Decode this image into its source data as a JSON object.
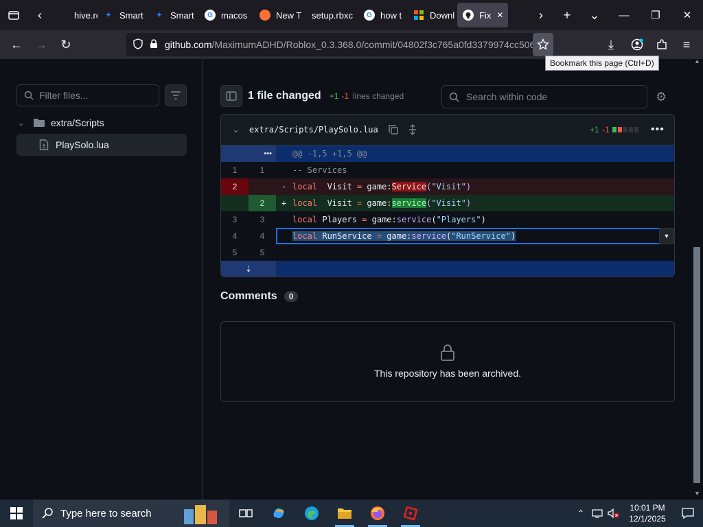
{
  "browser": {
    "tabs": [
      {
        "label": "hive.ro",
        "favicon": "archive-icon"
      },
      {
        "label": "Smart",
        "favicon": "bird-icon"
      },
      {
        "label": "Smart",
        "favicon": "bird-icon"
      },
      {
        "label": "macos",
        "favicon": "google-icon"
      },
      {
        "label": "New T",
        "favicon": "firefox-icon"
      },
      {
        "label": "setup.rbxc",
        "favicon": "none"
      },
      {
        "label": "how t",
        "favicon": "google-icon"
      },
      {
        "label": "Downl",
        "favicon": "windows-icon"
      },
      {
        "label": "Fix",
        "favicon": "github-icon",
        "active": true
      }
    ],
    "url_host": "github.com",
    "url_path": "/MaximumADHD/Roblox_0.3.368.0/commit/04802f3c765a0fd3379974cc506",
    "tooltip": "Bookmark this page (Ctrl+D)"
  },
  "sidebar": {
    "filter_placeholder": "Filter files...",
    "folder": "extra/Scripts",
    "file": "PlaySolo.lua"
  },
  "diff_summary": {
    "files_changed": "1 file changed",
    "additions": "+1",
    "deletions": "-1",
    "lines_changed": "lines changed",
    "search_placeholder": "Search within code"
  },
  "file": {
    "path": "extra/Scripts/PlaySolo.lua",
    "additions": "+1",
    "deletions": "-1"
  },
  "diff": {
    "hunk": "@@ -1,5 +1,5 @@",
    "rows": [
      {
        "old": "1",
        "new": "1",
        "marker": "",
        "parts": [
          [
            "cm",
            "-- Services"
          ]
        ]
      },
      {
        "old": "2",
        "new": "",
        "marker": "-",
        "parts": [
          [
            "kw",
            "local"
          ],
          [
            "",
            "  Visit "
          ],
          [
            "kw",
            "="
          ],
          [
            "",
            " game:"
          ],
          [
            "hl-del",
            "Service"
          ],
          [
            "fn",
            "("
          ],
          [
            "str",
            "\"Visit\""
          ],
          [
            "fn",
            ")"
          ]
        ]
      },
      {
        "old": "",
        "new": "2",
        "marker": "+",
        "parts": [
          [
            "kw",
            "local"
          ],
          [
            "",
            "  Visit "
          ],
          [
            "kw",
            "="
          ],
          [
            "",
            " game:"
          ],
          [
            "hl-add",
            "service"
          ],
          [
            "fn",
            "("
          ],
          [
            "str",
            "\"Visit\""
          ],
          [
            "fn",
            ")"
          ]
        ]
      },
      {
        "old": "3",
        "new": "3",
        "marker": "",
        "parts": [
          [
            "kw",
            "local"
          ],
          [
            "",
            " Players "
          ],
          [
            "kw",
            "="
          ],
          [
            "",
            " game:"
          ],
          [
            "fn",
            "service"
          ],
          [
            "",
            "("
          ],
          [
            "str",
            "\"Players\""
          ],
          [
            "",
            ")"
          ]
        ]
      },
      {
        "old": "4",
        "new": "4",
        "marker": "",
        "parts": [
          [
            "kw",
            "local"
          ],
          [
            "",
            " RunService "
          ],
          [
            "kw",
            "="
          ],
          [
            "",
            " game:"
          ],
          [
            "fn",
            "service"
          ],
          [
            "",
            "("
          ],
          [
            "str",
            "\"RunService\""
          ],
          [
            "",
            ")"
          ]
        ]
      },
      {
        "old": "5",
        "new": "5",
        "marker": "",
        "parts": []
      }
    ]
  },
  "comments": {
    "title": "Comments",
    "count": "0",
    "archived_message": "This repository has been archived."
  },
  "taskbar": {
    "search_placeholder": "Type here to search",
    "time": "10:01 PM",
    "date": "12/1/2025"
  }
}
